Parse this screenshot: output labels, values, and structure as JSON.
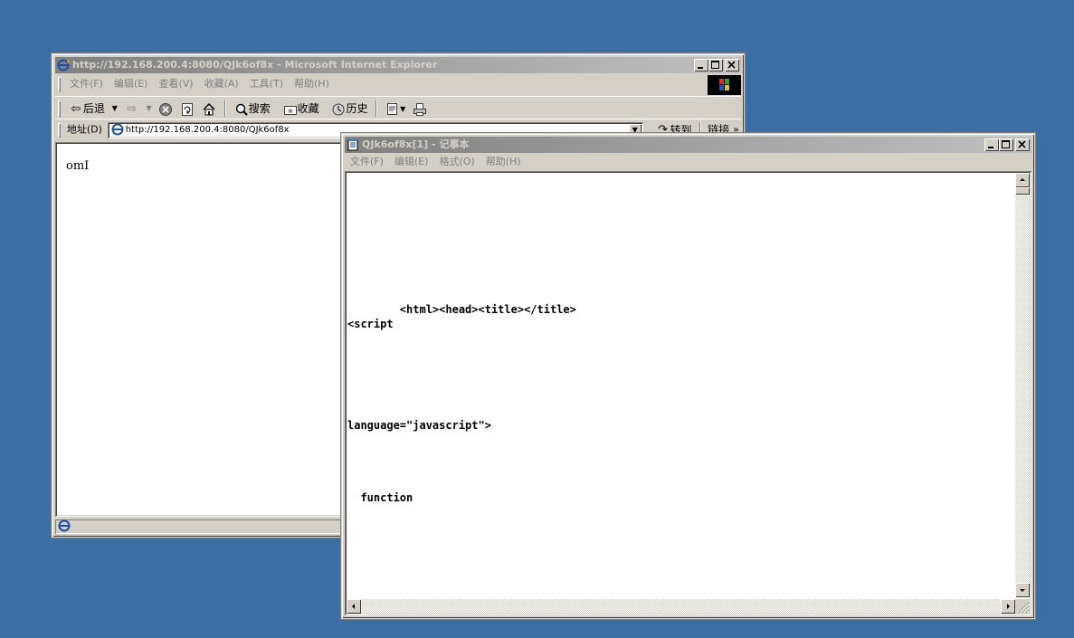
{
  "ie": {
    "title": "http://192.168.200.4:8080/QJk6of8x - Microsoft Internet Explorer",
    "menu": [
      "文件(F)",
      "编辑(E)",
      "查看(V)",
      "收藏(A)",
      "工具(T)",
      "帮助(H)"
    ],
    "toolbar": {
      "back": "后退",
      "search": "搜索",
      "favorites": "收藏",
      "history": "历史"
    },
    "address": {
      "label": "地址(D)",
      "value": "http://192.168.200.4:8080/QJk6of8x",
      "go": "转到",
      "links": "链接"
    },
    "content_text": "omI"
  },
  "notepad": {
    "title": "QJk6of8x[1] - 记事本",
    "menu": [
      "文件(F)",
      "编辑(E)",
      "格式(O)",
      "帮助(H)"
    ],
    "lines": [
      "        <html><head><title></title>",
      "<script",
      "language=\"javascript\">",
      "  function"
    ]
  },
  "colors": {
    "desktop": "#3a6ea5",
    "face": "#d4d0c8",
    "inactive_title_start": "#808080",
    "inactive_title_end": "#c0c0c0"
  }
}
